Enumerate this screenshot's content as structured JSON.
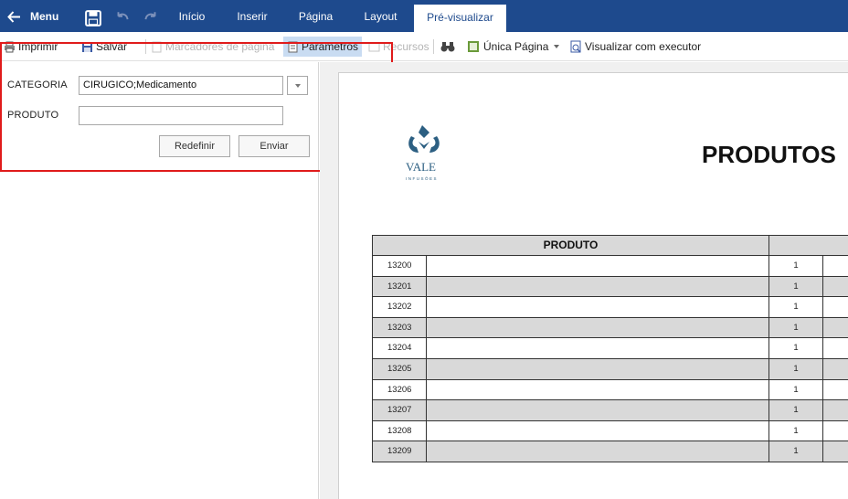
{
  "topbar": {
    "menu_label": "Menu",
    "tabs": [
      {
        "label": "Início"
      },
      {
        "label": "Inserir"
      },
      {
        "label": "Página"
      },
      {
        "label": "Layout"
      },
      {
        "label": "Pré-visualizar"
      }
    ],
    "active_tab": "Pré-visualizar",
    "colors": {
      "background": "#1e4a8d",
      "text": "#ffffff"
    }
  },
  "toolbar": {
    "items": [
      {
        "label": "Imprimir",
        "icon": "printer-icon"
      },
      {
        "label": "Salvar",
        "icon": "save-icon"
      },
      {
        "label": "Marcadores de página",
        "icon": "bookmark-icon",
        "disabled": true
      },
      {
        "label": "Parâmetros",
        "icon": "parameters-icon",
        "selected": true
      },
      {
        "label": "Recursos",
        "icon": "resources-icon",
        "disabled": true
      },
      {
        "label": "",
        "icon": "binoculars-icon"
      },
      {
        "label": "Única Página",
        "icon": "single-page-icon",
        "dropdown": true
      },
      {
        "label": "Visualizar com executor",
        "icon": "viewer-icon"
      }
    ]
  },
  "parameters": {
    "categoria": {
      "label": "CATEGORIA",
      "value": "CIRUGICO;Medicamento"
    },
    "produto": {
      "label": "PRODUTO",
      "value": ""
    },
    "reset_label": "Redefinir",
    "submit_label": "Enviar",
    "highlight_color": "#e01b1b"
  },
  "report": {
    "title": "PRODUTOS",
    "logo_text": "VALE",
    "logo_subtext": "INFUSÕES",
    "column_header": "PRODUTO",
    "rows": [
      {
        "code": "13200",
        "qty": "1"
      },
      {
        "code": "13201",
        "qty": "1"
      },
      {
        "code": "13202",
        "qty": "1"
      },
      {
        "code": "13203",
        "qty": "1"
      },
      {
        "code": "13204",
        "qty": "1"
      },
      {
        "code": "13205",
        "qty": "1"
      },
      {
        "code": "13206",
        "qty": "1"
      },
      {
        "code": "13207",
        "qty": "1"
      },
      {
        "code": "13208",
        "qty": "1"
      },
      {
        "code": "13209",
        "qty": "1"
      }
    ]
  }
}
